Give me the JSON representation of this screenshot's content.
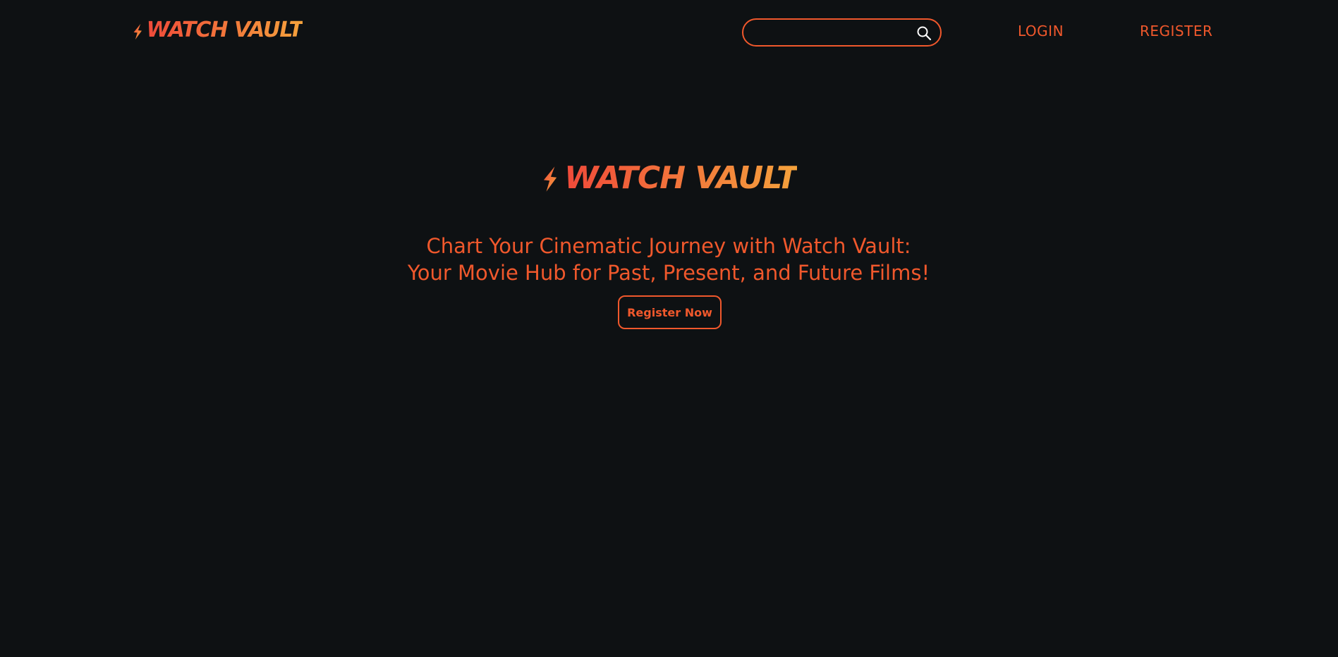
{
  "header": {
    "logo_text": "WATCH VAULT",
    "search": {
      "value": "",
      "placeholder": ""
    },
    "nav": {
      "login_label": "LOGIN",
      "register_label": "REGISTER"
    }
  },
  "hero": {
    "logo_text": "WATCH VAULT",
    "title_line_1": "Chart Your Cinematic Journey with Watch Vault:",
    "title_line_2": "Your Movie Hub for Past, Present, and Future Films!",
    "cta_label": "Register Now"
  },
  "colors": {
    "background": "#0e1113",
    "accent": "#f0582c",
    "gradient_start": "#f04a3a",
    "gradient_end": "#f4a23c"
  },
  "icons": {
    "logo_mark": "lightning-bolt-icon",
    "search": "search-icon"
  }
}
